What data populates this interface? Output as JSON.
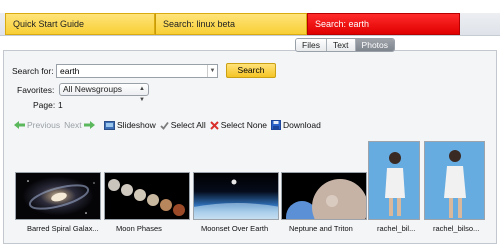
{
  "tabs": [
    {
      "label": "Quick Start Guide"
    },
    {
      "label": "Search: linux beta"
    },
    {
      "label": "Search: earth"
    }
  ],
  "view_modes": [
    {
      "label": "Files",
      "active": false
    },
    {
      "label": "Text",
      "active": false
    },
    {
      "label": "Photos",
      "active": true
    }
  ],
  "search": {
    "label": "Search for:",
    "value": "earth",
    "button": "Search"
  },
  "favorites": {
    "label": "Favorites:",
    "selected": "All Newsgroups"
  },
  "page": {
    "label": "Page:",
    "number": "1"
  },
  "toolbar": {
    "previous": "Previous",
    "next": "Next",
    "slideshow": "Slideshow",
    "select_all": "Select All",
    "select_none": "Select None",
    "download": "Download"
  },
  "thumbnails": [
    {
      "caption": "Barred Spiral Galax..."
    },
    {
      "caption": "Moon Phases"
    },
    {
      "caption": "Moonset Over Earth"
    },
    {
      "caption": "Neptune and Triton"
    },
    {
      "caption": "rachel_bil..."
    },
    {
      "caption": "rachel_bilso..."
    }
  ],
  "colors": {
    "tab_yellow": "#f8cf35",
    "tab_red": "#e00000",
    "button_yellow": "#f5c525",
    "nav_arrow_green": "#5cb85c",
    "select_none_red": "#d9302c",
    "download_blue": "#2a62c9"
  },
  "icons": {
    "prev": "arrow-left-icon",
    "next": "arrow-right-icon",
    "slideshow": "slideshow-icon",
    "select_all": "checkmark-icon",
    "select_none": "x-icon",
    "download": "floppy-disk-icon"
  }
}
